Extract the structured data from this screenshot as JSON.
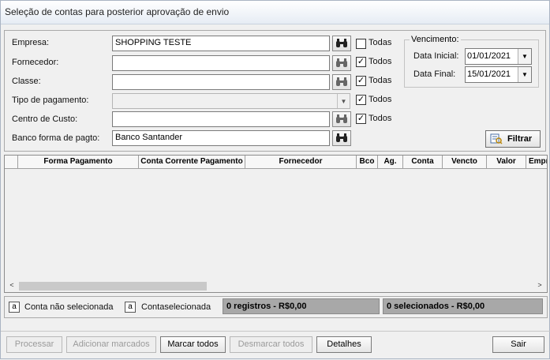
{
  "window": {
    "title": "Seleção de contas para posterior aprovação de envio"
  },
  "filters": {
    "empresa": {
      "label": "Empresa:",
      "value": "SHOPPING TESTE",
      "all_label": "Todas",
      "all_checked": false
    },
    "fornecedor": {
      "label": "Fornecedor:",
      "value": "",
      "all_label": "Todos",
      "all_checked": true
    },
    "classe": {
      "label": "Classe:",
      "value": "",
      "all_label": "Todas",
      "all_checked": true
    },
    "tipo_pagamento": {
      "label": "Tipo de pagamento:",
      "value": "",
      "all_label": "Todos",
      "all_checked": true
    },
    "centro_custo": {
      "label": "Centro de Custo:",
      "value": "",
      "all_label": "Todos",
      "all_checked": true
    },
    "banco": {
      "label": "Banco forma de pagto:",
      "value": "Banco Santander"
    }
  },
  "vencimento": {
    "legend": "Vencimento:",
    "inicial_label": "Data Inicial:",
    "inicial_value": "01/01/2021",
    "final_label": "Data Final:",
    "final_value": "15/01/2021"
  },
  "filtrar_label": "Filtrar",
  "grid": {
    "columns": [
      "Forma Pagamento",
      "Conta Corrente Pagamento",
      "Fornecedor",
      "Bco",
      "Ag.",
      "Conta",
      "Vencto",
      "Valor",
      "Empr"
    ]
  },
  "legend_bar": {
    "not_selected_swatch": "a",
    "not_selected_label": "Conta não selecionada",
    "selected_swatch": "a",
    "selected_label": "Contaselecionada",
    "records": "0 registros - R$0,00",
    "selected": "0 selecionados - R$0,00"
  },
  "buttons": {
    "processar": "Processar",
    "adicionar": "Adicionar marcados",
    "marcar": "Marcar todos",
    "desmarcar": "Desmarcar todos",
    "detalhes": "Detalhes",
    "sair": "Sair"
  },
  "colors": {
    "status_bg": "#a8a8a8",
    "window_bg": "#f0f0f0"
  }
}
